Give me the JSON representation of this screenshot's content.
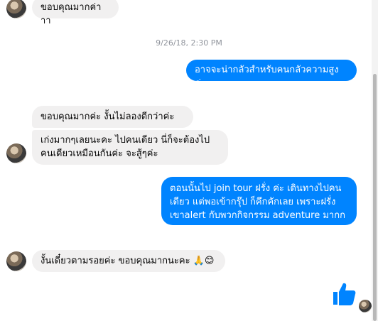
{
  "timestamp": "9/26/18, 2:30 PM",
  "messages": [
    {
      "text": "ขอบคุณมากค่าาา"
    },
    {
      "text": "อาจจะน่ากลัวสำหรับคนกลัวความสูงค่ะ"
    },
    {
      "text": "ขอบคุณมากค่ะ งั้นไม่ลองดีกว่าค่ะ"
    },
    {
      "text": "เก่งมากๆเลยนะคะ ไปคนเดียว นี่ก็จะต้องไปคนเดียวเหมือนกันค่ะ จะสู้ๆค่ะ"
    },
    {
      "text": "ตอนนั้นไป join tour ฝรั่ง ค่ะ เดินทางไปคนเดียว แต่พอเข้ากรุ๊ป ก็คึกคักเลย เพราะฝรั่งเขาalert กับพวกกิจกรรม adventure มากก"
    },
    {
      "text": "งั้นเดี๋ยวตามรอยค่ะ ขอบคุณมากนะคะ 🙏😊"
    }
  ],
  "icons": {
    "like": "thumbs-up-icon",
    "accent": "#0084ff"
  }
}
